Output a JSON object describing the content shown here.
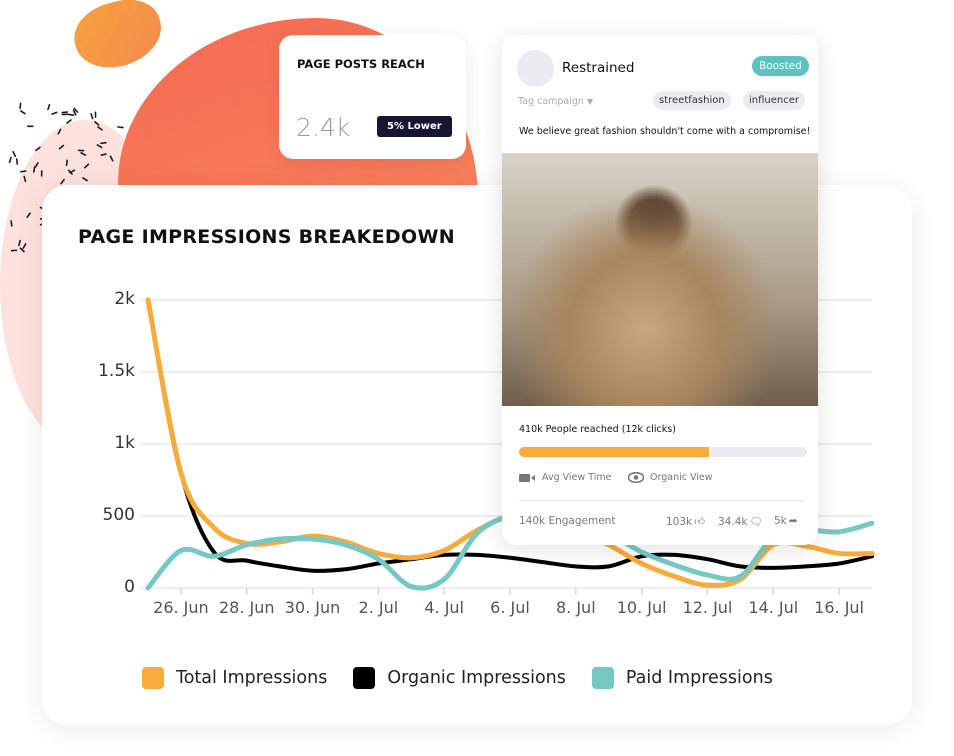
{
  "reach_card": {
    "title": "PAGE POSTS REACH",
    "value": "2.4k",
    "badge": "5% Lower"
  },
  "post": {
    "name": "Restrained",
    "badge": "Boosted",
    "tag_campaign": "Tag campaign",
    "tags": [
      "streetfashion",
      "influencer"
    ],
    "caption": "We believe great fashion shouldn't come with a compromise!",
    "reach_text": "410k People reached (12k clicks)",
    "reach_progress": 0.66,
    "avg_view": "Avg View Time",
    "organic_view": "Organic View",
    "engagement": "140k Engagement",
    "likes": "103k",
    "comments": "34.4k",
    "shares": "5k"
  },
  "colors": {
    "total": "#f8ab3a",
    "organic": "#000000",
    "paid": "#76c8c5",
    "accent": "#5ec3bf"
  },
  "chart_data": {
    "type": "line",
    "title": "PAGE IMPRESSIONS BREAKEDOWN",
    "x": [
      "25 Jun",
      "26 Jun",
      "27 Jun",
      "28 Jun",
      "29 Jun",
      "30 Jun",
      "1 Jul",
      "2 Jul",
      "3 Jul",
      "4 Jul",
      "5 Jul",
      "6 Jul",
      "7 Jul",
      "8 Jul",
      "9 Jul",
      "10 Jul",
      "11 Jul",
      "12 Jul",
      "13 Jul",
      "14 Jul",
      "15 Jul",
      "16 Jul",
      "17 Jul"
    ],
    "x_tick_labels": [
      "26. Jun",
      "28. Jun",
      "30. Jun",
      "2. Jul",
      "4. Jul",
      "6. Jul",
      "8. Jul",
      "10. Jul",
      "12. Jul",
      "14. Jul",
      "16. Jul"
    ],
    "y_tick_labels": [
      "0",
      "500",
      "1k",
      "1.5k",
      "2k"
    ],
    "ylim": [
      0,
      2000
    ],
    "grid": true,
    "legend": "bottom",
    "series": [
      {
        "name": "Total Impressions",
        "values": [
          2000,
          800,
          420,
          310,
          320,
          360,
          320,
          240,
          210,
          260,
          400,
          500,
          480,
          400,
          300,
          170,
          80,
          20,
          60,
          300,
          290,
          240,
          240
        ]
      },
      {
        "name": "Organic Impressions",
        "values": [
          2000,
          800,
          250,
          190,
          150,
          120,
          130,
          170,
          200,
          230,
          230,
          210,
          180,
          150,
          150,
          220,
          230,
          200,
          150,
          140,
          150,
          170,
          220
        ]
      },
      {
        "name": "Paid Impressions",
        "values": [
          0,
          260,
          220,
          300,
          340,
          340,
          300,
          200,
          10,
          60,
          380,
          500,
          520,
          470,
          380,
          250,
          160,
          90,
          80,
          350,
          400,
          390,
          450
        ]
      }
    ]
  }
}
